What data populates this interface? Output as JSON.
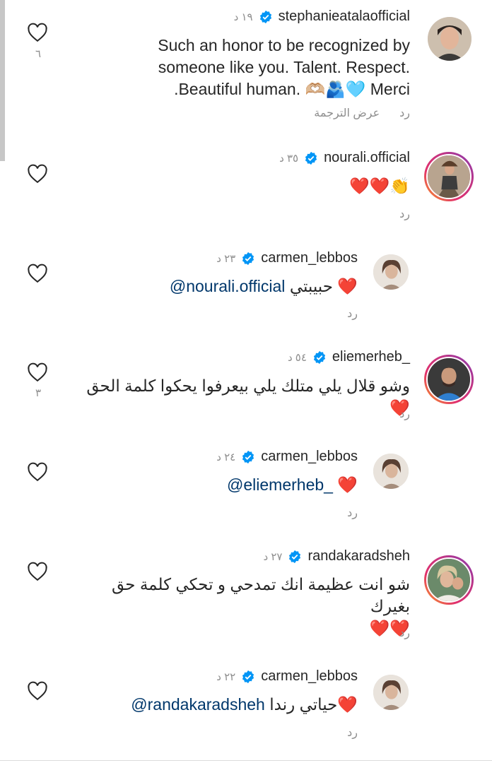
{
  "comments": [
    {
      "username": "stephanieatalaofficial",
      "time": "١٩ د",
      "text_lines": [
        "Such an honor to be recognized by",
        "someone like you. Talent. Respect.",
        ".Beautiful human. 🫶🏼🫂🩵 Merci"
      ],
      "reply": "رد",
      "translate": "عرض الترجمة",
      "likes": "٦",
      "avatar_style": "plain"
    },
    {
      "username": "nourali.official",
      "time": "٣٥ د",
      "text": "❤️❤️👏",
      "reply": "رد",
      "likes": "",
      "avatar_style": "ring"
    },
    {
      "username": "carmen_lebbos",
      "time": "٢٣ د",
      "mention": "@nourali.official",
      "text": "حبيبتي ❤️",
      "reply": "رد",
      "likes": "",
      "avatar_style": "plain"
    },
    {
      "username": "eliemerheb_",
      "time": "٥٤ د",
      "text": "وشو قلال يلي متلك يلي بيعرفوا يحكوا كلمة الحق ❤️",
      "reply": "رد",
      "likes": "٣",
      "avatar_style": "ring"
    },
    {
      "username": "carmen_lebbos",
      "time": "٢٤ د",
      "mention": "@eliemerheb_",
      "text": "❤️",
      "reply": "رد",
      "likes": "",
      "avatar_style": "plain"
    },
    {
      "username": "randakaradsheh",
      "time": "٢٧ د",
      "text_lines": [
        "شو انت عظيمة انك تمدحي و تحكي كلمة حق بغيرك",
        "❤️❤️"
      ],
      "reply": "رد",
      "likes": "",
      "avatar_style": "ring"
    },
    {
      "username": "carmen_lebbos",
      "time": "٢٢ د",
      "mention": "@randakaradsheh",
      "text": "حياتي رندا❤️",
      "reply": "رد",
      "likes": "",
      "avatar_style": "plain"
    }
  ],
  "colors": {
    "text": "#262626",
    "meta": "#8e8e8e",
    "mention": "#00376b",
    "verified": "#0095f6"
  },
  "icons": {
    "like": "heart-outline-icon",
    "verified": "verified-badge-icon"
  }
}
